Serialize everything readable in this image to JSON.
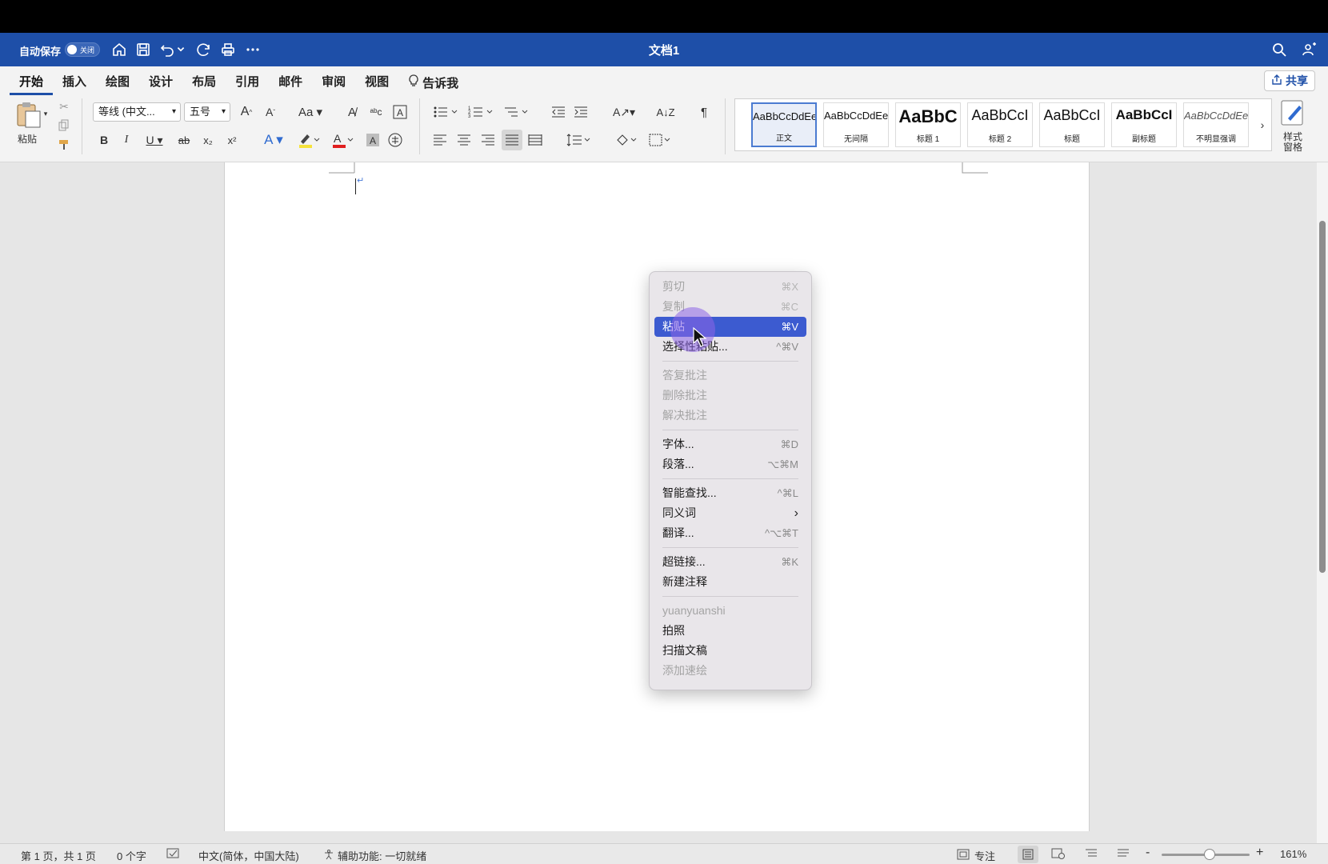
{
  "titlebar": {
    "autosave_label": "自动保存",
    "autosave_state": "关闭",
    "document_title": "文档1"
  },
  "tabs": [
    "开始",
    "插入",
    "绘图",
    "设计",
    "布局",
    "引用",
    "邮件",
    "审阅",
    "视图"
  ],
  "tell_me": "告诉我",
  "share_label": "共享",
  "ribbon": {
    "paste_label": "粘贴",
    "font_name": "等线 (中文...",
    "font_size": "五号",
    "styles_pane_label": "样式\n窗格"
  },
  "styles": [
    {
      "sample": "AaBbCcDdEe",
      "name": "正文",
      "size": 13,
      "bold": false,
      "italic": false
    },
    {
      "sample": "AaBbCcDdEe",
      "name": "无间隔",
      "size": 13,
      "bold": false,
      "italic": false
    },
    {
      "sample": "AaBbC",
      "name": "标题 1",
      "size": 22,
      "bold": true,
      "italic": false
    },
    {
      "sample": "AaBbCcI",
      "name": "标题 2",
      "size": 18,
      "bold": false,
      "italic": false
    },
    {
      "sample": "AaBbCcI",
      "name": "标题",
      "size": 18,
      "bold": false,
      "italic": false
    },
    {
      "sample": "AaBbCcI",
      "name": "副标题",
      "size": 17,
      "bold": true,
      "italic": false
    },
    {
      "sample": "AaBbCcDdEe",
      "name": "不明显强调",
      "size": 13,
      "bold": false,
      "italic": true
    }
  ],
  "context_menu": {
    "items": [
      {
        "label": "剪切",
        "shortcut": "⌘X",
        "disabled": true
      },
      {
        "label": "复制",
        "shortcut": "⌘C",
        "disabled": true
      },
      {
        "label": "粘贴",
        "shortcut": "⌘V",
        "highlighted": true
      },
      {
        "label": "选择性粘贴...",
        "shortcut": "^⌘V"
      },
      {
        "separator": true
      },
      {
        "label": "答复批注",
        "disabled": true
      },
      {
        "label": "删除批注",
        "disabled": true
      },
      {
        "label": "解决批注",
        "disabled": true
      },
      {
        "separator": true
      },
      {
        "label": "字体...",
        "shortcut": "⌘D"
      },
      {
        "label": "段落...",
        "shortcut": "⌥⌘M"
      },
      {
        "separator": true
      },
      {
        "label": "智能查找...",
        "shortcut": "^⌘L"
      },
      {
        "label": "同义词",
        "submenu": true
      },
      {
        "label": "翻译...",
        "shortcut": "^⌥⌘T"
      },
      {
        "separator": true
      },
      {
        "label": "超链接...",
        "shortcut": "⌘K"
      },
      {
        "label": "新建注释"
      },
      {
        "separator": true
      },
      {
        "label": "yuanyuanshi",
        "disabled": true
      },
      {
        "label": "拍照"
      },
      {
        "label": "扫描文稿"
      },
      {
        "label": "添加速绘",
        "disabled": true
      }
    ]
  },
  "statusbar": {
    "page": "第 1 页，共 1 页",
    "words": "0 个字",
    "language": "中文(简体，中国大陆)",
    "accessibility": "辅助功能: 一切就绪",
    "focus": "专注",
    "zoom": "161%",
    "zoom_minus": "-",
    "zoom_plus": "+"
  }
}
